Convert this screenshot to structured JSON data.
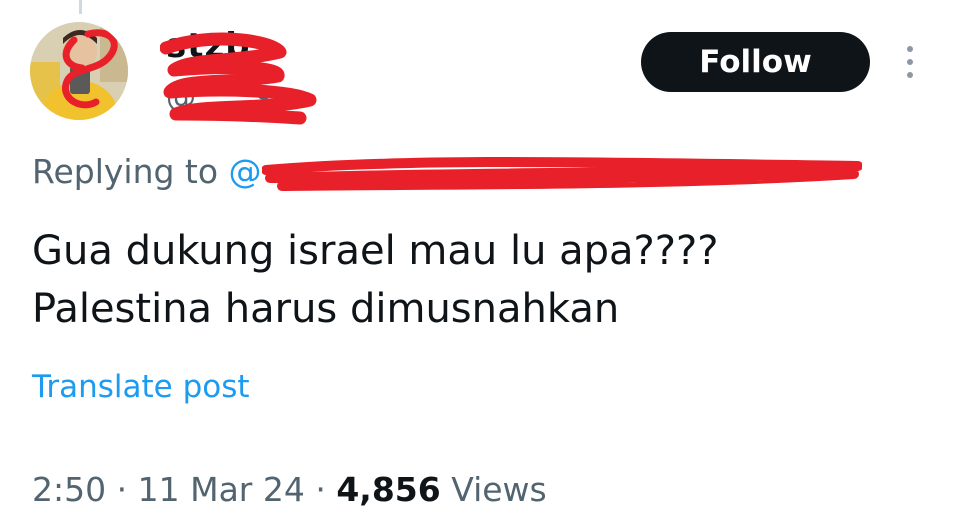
{
  "author": {
    "display_name": "stzb",
    "handle": "@____s"
  },
  "follow_button": {
    "label": "Follow"
  },
  "more_menu": {
    "icon": "more-vertical-icon"
  },
  "reply": {
    "prefix": "Replying to",
    "mention": "@"
  },
  "post": {
    "lines": [
      "Gua dukung israel mau lu apa????",
      "Palestina harus dimusnahkan"
    ]
  },
  "translate_link": "Translate post",
  "meta": {
    "time": "2:50",
    "separator": "·",
    "date": "11 Mar 24",
    "views_count": "4,856",
    "views_label": "Views"
  },
  "colors": {
    "text": "#0f1419",
    "secondary": "#536471",
    "link": "#1d9bf0",
    "follow_bg": "#0f1419",
    "redaction": "#e8202a"
  }
}
